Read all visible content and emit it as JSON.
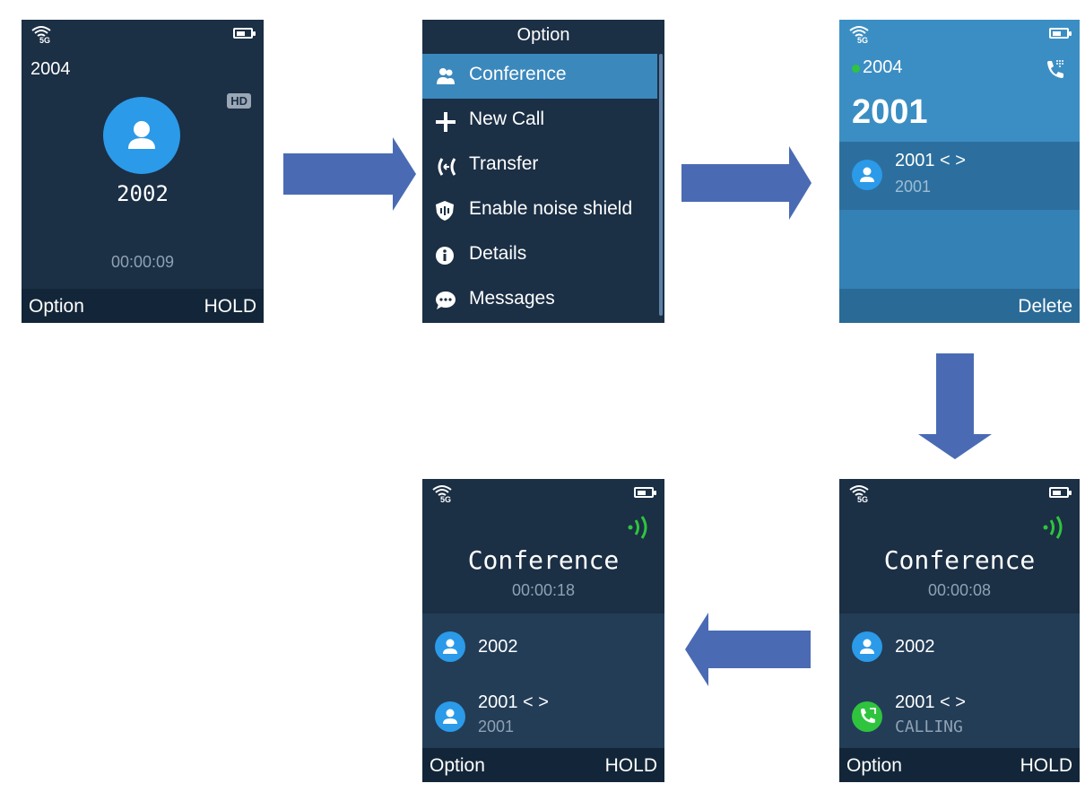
{
  "screens": {
    "call": {
      "line": "2004",
      "hd_badge": "HD",
      "number": "2002",
      "timer": "00:00:09",
      "soft_left": "Option",
      "soft_right": "HOLD"
    },
    "option_menu": {
      "title": "Option",
      "items": [
        {
          "label": "Conference",
          "icon": "conference-icon"
        },
        {
          "label": "New Call",
          "icon": "plus-icon"
        },
        {
          "label": "Transfer",
          "icon": "transfer-icon"
        },
        {
          "label": "Enable noise shield",
          "icon": "shield-icon"
        },
        {
          "label": "Details",
          "icon": "info-icon"
        },
        {
          "label": "Messages",
          "icon": "message-icon"
        }
      ]
    },
    "dial": {
      "line": "2004",
      "number": "2001",
      "entry_name": "2001 < >",
      "entry_sub": "2001",
      "soft_right": "Delete"
    },
    "conference_calling": {
      "title": "Conference",
      "timer": "00:00:08",
      "p1": "2002",
      "p2_name": "2001 < >",
      "p2_status": "CALLING",
      "soft_left": "Option",
      "soft_right": "HOLD"
    },
    "conference_active": {
      "title": "Conference",
      "timer": "00:00:18",
      "p1": "2002",
      "p2_name": "2001 < >",
      "p2_sub": "2001",
      "soft_left": "Option",
      "soft_right": "HOLD"
    }
  },
  "colors": {
    "screen_bg": "#1b2f45",
    "highlight": "#3b88bd",
    "avatar": "#2b9ae8",
    "green": "#2fc43e",
    "arrow": "#4a6bb4"
  }
}
